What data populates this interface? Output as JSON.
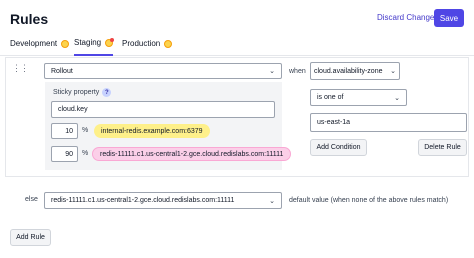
{
  "header": {
    "title": "Rules",
    "discard_label": "Discard Changes",
    "save_label": "Save"
  },
  "tabs": [
    {
      "label": "Development",
      "active": false
    },
    {
      "label": "Staging",
      "active": true
    },
    {
      "label": "Production",
      "active": false
    }
  ],
  "rule": {
    "type_value": "Rollout",
    "when_label": "when",
    "context_value": "cloud.availability-zone",
    "operator_value": "is one of",
    "match_value": "us-east-1a",
    "add_condition_label": "Add Condition",
    "delete_rule_label": "Delete Rule",
    "sticky_label": "Sticky property",
    "sticky_help": "?",
    "sticky_value": "cloud.key",
    "percent_symbol": "%",
    "variants": [
      {
        "percent": "10",
        "value": "internal-redis.example.com:6379",
        "color": "#fef08a"
      },
      {
        "percent": "90",
        "value": "redis-11111.c1.us-central1-2.gce.cloud.redislabs.com:11111",
        "color": "#fbcfe8"
      }
    ]
  },
  "else": {
    "label": "else",
    "value": "redis-11111.c1.us-central1-2.gce.cloud.redislabs.com:11111",
    "default_text": "default value (when none of the above rules match)"
  },
  "add_rule_label": "Add Rule",
  "colors": {
    "accent": "#4f46e5",
    "link": "#4338ca"
  }
}
